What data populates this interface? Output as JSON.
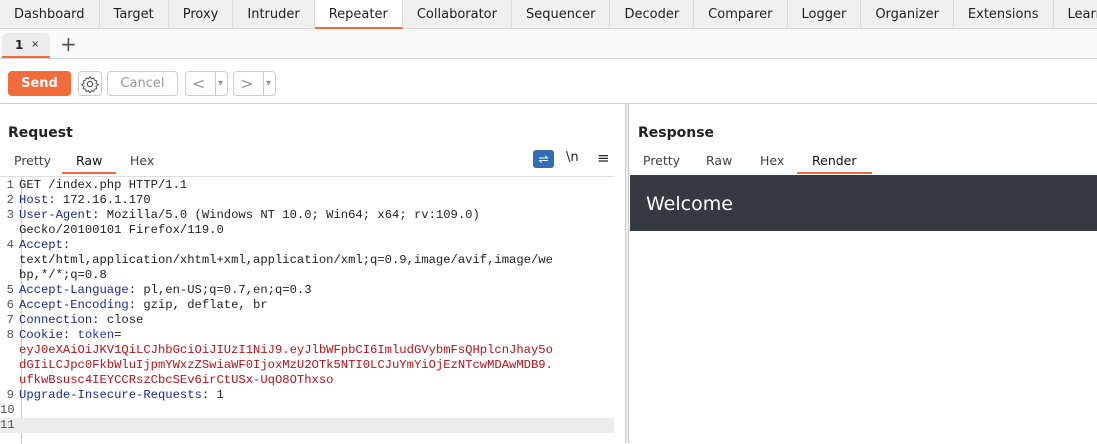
{
  "topnav": [
    "Dashboard",
    "Target",
    "Proxy",
    "Intruder",
    "Repeater",
    "Collaborator",
    "Sequencer",
    "Decoder",
    "Comparer",
    "Logger",
    "Organizer",
    "Extensions",
    "Learn"
  ],
  "repeater_tab": {
    "label": "1",
    "close": "×",
    "add": "+"
  },
  "toolbar": {
    "send": "Send",
    "cancel": "Cancel",
    "back": "<",
    "forward": ">",
    "dropdown": "▾"
  },
  "request": {
    "title": "Request",
    "tabs": [
      "Pretty",
      "Raw",
      "Hex"
    ],
    "active_tab": "Raw",
    "newline_toggle": "\\n",
    "lines": [
      {
        "n": "1",
        "parts": [
          {
            "c": "hv",
            "t": "GET /index.php HTTP/1.1"
          }
        ]
      },
      {
        "n": "2",
        "parts": [
          {
            "c": "hk",
            "t": "Host"
          },
          {
            "c": "hv",
            "t": ": 172.16.1.170"
          }
        ]
      },
      {
        "n": "3",
        "parts": [
          {
            "c": "hk",
            "t": "User-Agent"
          },
          {
            "c": "hv",
            "t": ": Mozilla/5.0 (Windows NT 10.0; Win64; x64; rv:109.0)"
          }
        ]
      },
      {
        "n": "",
        "parts": [
          {
            "c": "hv",
            "t": "Gecko/20100101 Firefox/119.0"
          }
        ]
      },
      {
        "n": "4",
        "parts": [
          {
            "c": "hk",
            "t": "Accept"
          },
          {
            "c": "hv",
            "t": ":"
          }
        ]
      },
      {
        "n": "",
        "parts": [
          {
            "c": "hv",
            "t": "text/html,application/xhtml+xml,application/xml;q=0.9,image/avif,image/we"
          }
        ]
      },
      {
        "n": "",
        "parts": [
          {
            "c": "hv",
            "t": "bp,*/*;q=0.8"
          }
        ]
      },
      {
        "n": "5",
        "parts": [
          {
            "c": "hk",
            "t": "Accept-Language"
          },
          {
            "c": "hv",
            "t": ": pl,en-US;q=0.7,en;q=0.3"
          }
        ]
      },
      {
        "n": "6",
        "parts": [
          {
            "c": "hk",
            "t": "Accept-Encoding"
          },
          {
            "c": "hv",
            "t": ": gzip, deflate, br"
          }
        ]
      },
      {
        "n": "7",
        "parts": [
          {
            "c": "hk",
            "t": "Connection"
          },
          {
            "c": "hv",
            "t": ": close"
          }
        ]
      },
      {
        "n": "8",
        "parts": [
          {
            "c": "hk",
            "t": "Cookie"
          },
          {
            "c": "hv",
            "t": ": "
          },
          {
            "c": "tk",
            "t": "token"
          },
          {
            "c": "hv",
            "t": "="
          }
        ]
      },
      {
        "n": "",
        "parts": [
          {
            "c": "cv",
            "t": "eyJ0eXAiOiJKV1QiLCJhbGciOiJIUzI1NiJ9.eyJlbWFpbCI6ImludGVybmFsQHplcnJhay5o"
          }
        ]
      },
      {
        "n": "",
        "parts": [
          {
            "c": "cv",
            "t": "dGIiLCJpc0FkbWluIjpmYWxzZSwiaWF0IjoxMzU2OTk5NTI0LCJuYmYiOjEzNTcwMDAwMDB9."
          }
        ]
      },
      {
        "n": "",
        "parts": [
          {
            "c": "cv",
            "t": "ufkwBsusc4IEYCCRszCbcSEv6irCtUSx-UqO8OThxso"
          }
        ]
      },
      {
        "n": "9",
        "parts": [
          {
            "c": "hk",
            "t": "Upgrade-Insecure-Requests"
          },
          {
            "c": "hv",
            "t": ": 1"
          }
        ]
      },
      {
        "n": "10",
        "parts": []
      },
      {
        "n": "11",
        "parts": []
      }
    ]
  },
  "response": {
    "title": "Response",
    "tabs": [
      "Pretty",
      "Raw",
      "Hex",
      "Render"
    ],
    "active_tab": "Render",
    "render_heading": "Welcome"
  },
  "colors": {
    "accent": "#f26b3a",
    "render_bar": "#343a40"
  }
}
